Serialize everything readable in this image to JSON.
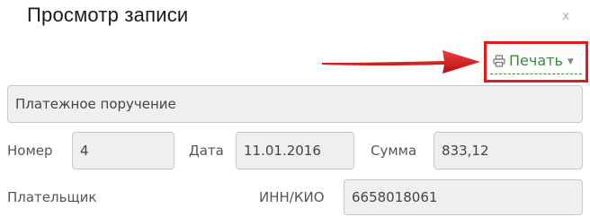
{
  "dialog": {
    "title": "Просмотр записи",
    "close_label": "x"
  },
  "toolbar": {
    "print_label": "Печать",
    "print_icon": "printer-icon",
    "highlight_color": "#e01b1b",
    "accent_color": "#3a8a3a"
  },
  "form": {
    "doc_type": "Платежное поручение",
    "number_label": "Номер",
    "number_value": "4",
    "date_label": "Дата",
    "date_value": "11.01.2016",
    "sum_label": "Сумма",
    "sum_value": "833,12",
    "payer_label": "Плательщик",
    "inn_label": "ИНН/КИО",
    "inn_value": "6658018061"
  }
}
